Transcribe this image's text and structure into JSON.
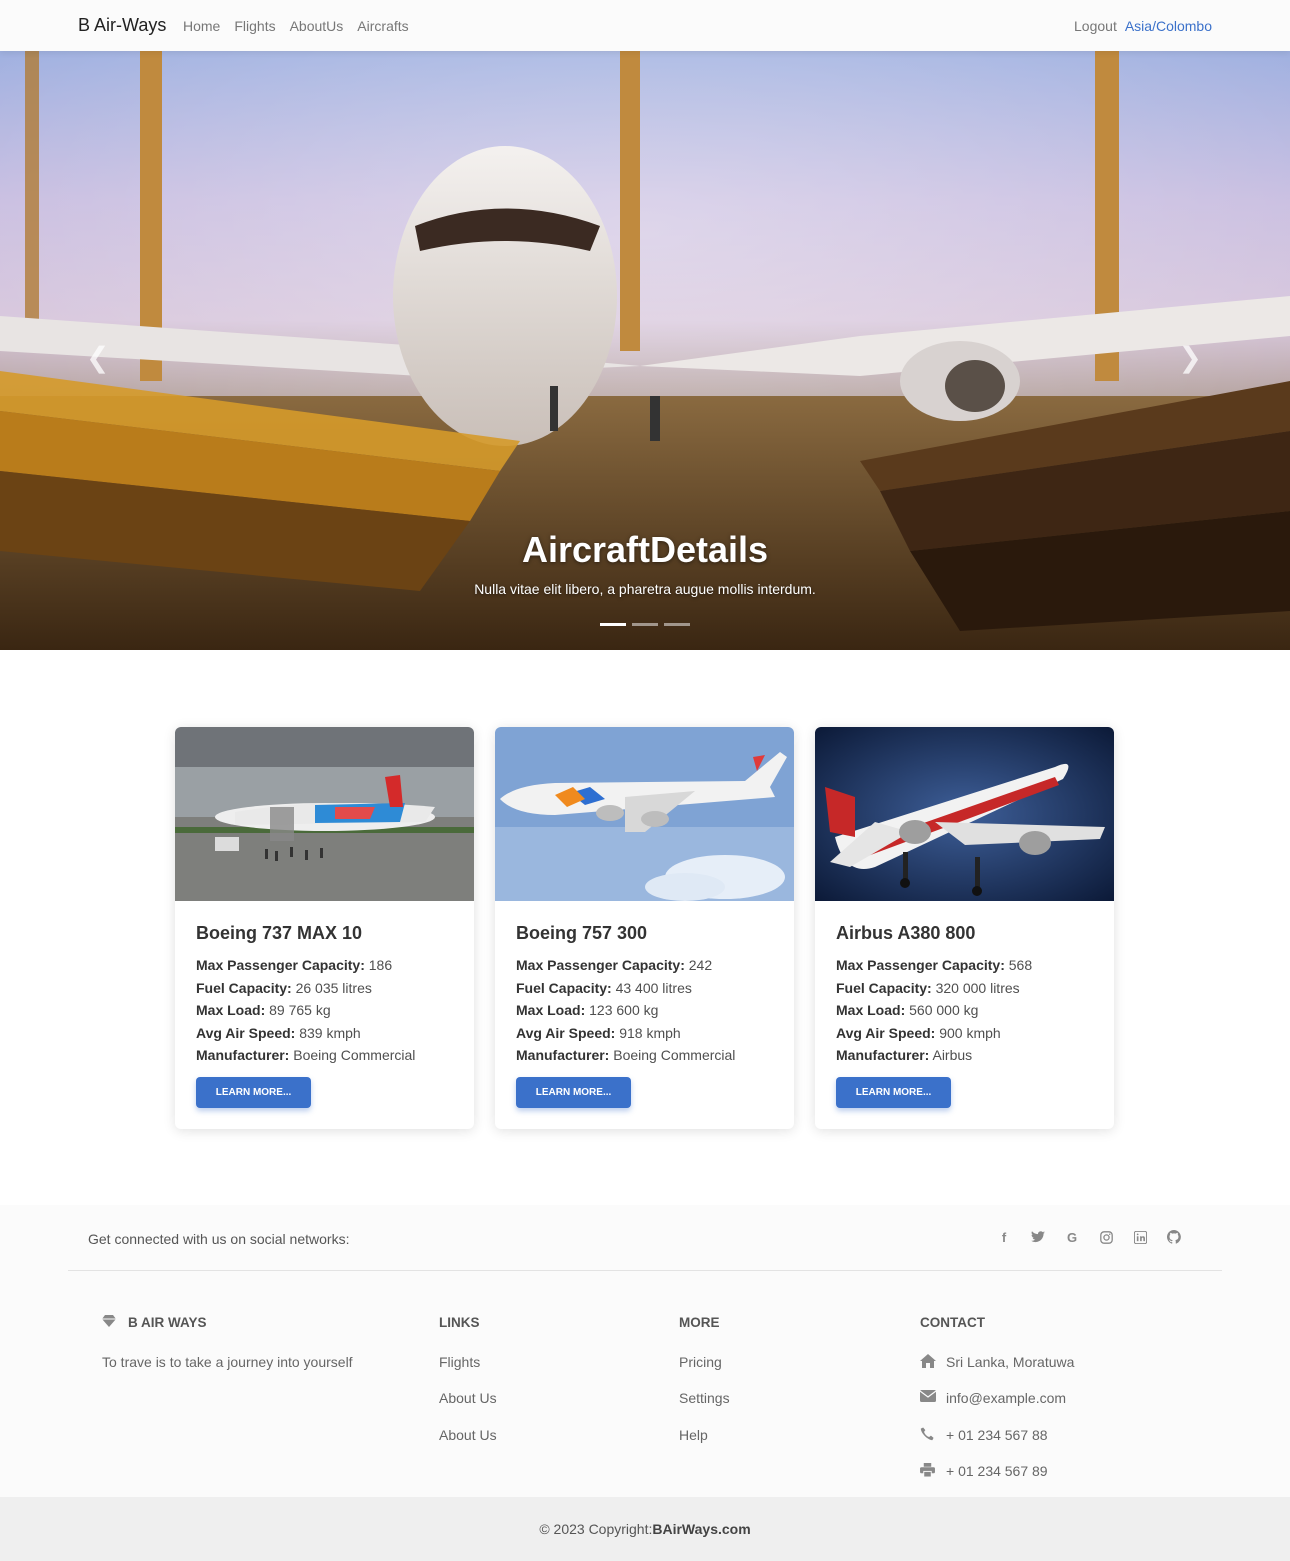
{
  "navbar": {
    "brand": "B Air-Ways",
    "links": [
      "Home",
      "Flights",
      "AboutUs",
      "Aircrafts"
    ],
    "logout": "Logout",
    "timezone": "Asia/Colombo"
  },
  "hero": {
    "title": "AircraftDetails",
    "subtitle": "Nulla vitae elit libero, a pharetra augue mollis interdum.",
    "prev_icon": "chevron-left-icon",
    "next_icon": "chevron-right-icon",
    "slide_count": 3,
    "active_slide": 1
  },
  "aircraft": [
    {
      "name": "Boeing 737 MAX 10",
      "passenger_label": "Max Passenger Capacity:",
      "passenger": "186",
      "fuel_label": "Fuel Capacity:",
      "fuel": "26 035 litres",
      "load_label": "Max Load:",
      "load": "89 765 kg",
      "speed_label": "Avg Air Speed:",
      "speed": "839 kmph",
      "manufacturer_label": "Manufacturer:",
      "manufacturer": "Boeing Commercial",
      "button": "Learn More..."
    },
    {
      "name": "Boeing 757 300",
      "passenger_label": "Max Passenger Capacity:",
      "passenger": "242",
      "fuel_label": "Fuel Capacity:",
      "fuel": "43 400 litres",
      "load_label": "Max Load:",
      "load": "123 600 kg",
      "speed_label": "Avg Air Speed:",
      "speed": "918 kmph",
      "manufacturer_label": "Manufacturer:",
      "manufacturer": "Boeing Commercial",
      "button": "Learn More..."
    },
    {
      "name": "Airbus A380 800",
      "passenger_label": "Max Passenger Capacity:",
      "passenger": "568",
      "fuel_label": "Fuel Capacity:",
      "fuel": "320 000 litres",
      "load_label": "Max Load:",
      "load": "560 000 kg",
      "speed_label": "Avg Air Speed:",
      "speed": "900 kmph",
      "manufacturer_label": "Manufacturer:",
      "manufacturer": "Airbus",
      "button": "Learn More..."
    }
  ],
  "footer": {
    "social_text": "Get connected with us on social networks:",
    "social_icons": [
      "facebook-icon",
      "twitter-icon",
      "google-icon",
      "instagram-icon",
      "linkedin-icon",
      "github-icon"
    ],
    "brand_heading": "B AIR WAYS",
    "brand_icon": "gem-icon",
    "tagline": "To trave is to take a journey into yourself",
    "links_heading": "LINKS",
    "links": [
      "Flights",
      "About Us",
      "About Us"
    ],
    "more_heading": "MORE",
    "more": [
      "Pricing",
      "Settings",
      "Help"
    ],
    "contact_heading": "CONTACT",
    "address": "Sri Lanka, Moratuwa",
    "email": "info@example.com",
    "phone": "+ 01 234 567 88",
    "fax": "+ 01 234 567 89",
    "copyright_prefix": "© 2023 Copyright:",
    "copyright_site": "BAirWays.com"
  }
}
